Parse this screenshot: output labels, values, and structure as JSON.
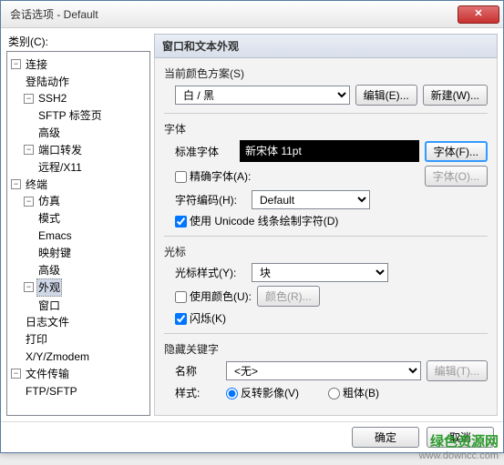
{
  "window": {
    "title": "会话选项 - Default"
  },
  "category_label": "类别(C):",
  "tree": {
    "connection": "连接",
    "login_actions": "登陆动作",
    "ssh2": "SSH2",
    "sftp_tab": "SFTP 标签页",
    "advanced": "高级",
    "port_forward": "端口转发",
    "remote_x11": "远程/X11",
    "terminal": "终端",
    "emulation": "仿真",
    "mode": "模式",
    "emacs": "Emacs",
    "keymap": "映射键",
    "advanced2": "高级",
    "appearance": "外观",
    "window_item": "窗口",
    "logfile": "日志文件",
    "print": "打印",
    "xyzmodem": "X/Y/Zmodem",
    "file_transfer": "文件传输",
    "ftp_sftp": "FTP/SFTP"
  },
  "section_title": "窗口和文本外观",
  "scheme": {
    "label": "当前颜色方案(S)",
    "value": "白 / 黑",
    "edit": "编辑(E)...",
    "new": "新建(W)..."
  },
  "font": {
    "group": "字体",
    "std_label": "标准字体",
    "sample": "新宋体  11pt",
    "font_btn": "字体(F)...",
    "precise_cb": "精确字体(A):",
    "font_btn2": "字体(O)...",
    "encoding_label": "字符编码(H):",
    "encoding_value": "Default",
    "unicode_cb": "使用 Unicode 线条绘制字符(D)"
  },
  "cursor": {
    "group": "光标",
    "style_label": "光标样式(Y):",
    "style_value": "块",
    "color_cb": "使用颜色(U):",
    "color_btn": "颜色(R)...",
    "blink_cb": "闪烁(K)"
  },
  "hidden": {
    "group": "隐藏关键字",
    "name_label": "名称",
    "name_value": "<无>",
    "edit_btn": "编辑(T)...",
    "style_label": "样式:",
    "reverse": "反转影像(V)",
    "bold": "粗体(B)"
  },
  "footer": {
    "ok": "确定",
    "cancel": "取消"
  },
  "watermark": {
    "name": "绿色资源网",
    "url": "www.downcc.com"
  }
}
